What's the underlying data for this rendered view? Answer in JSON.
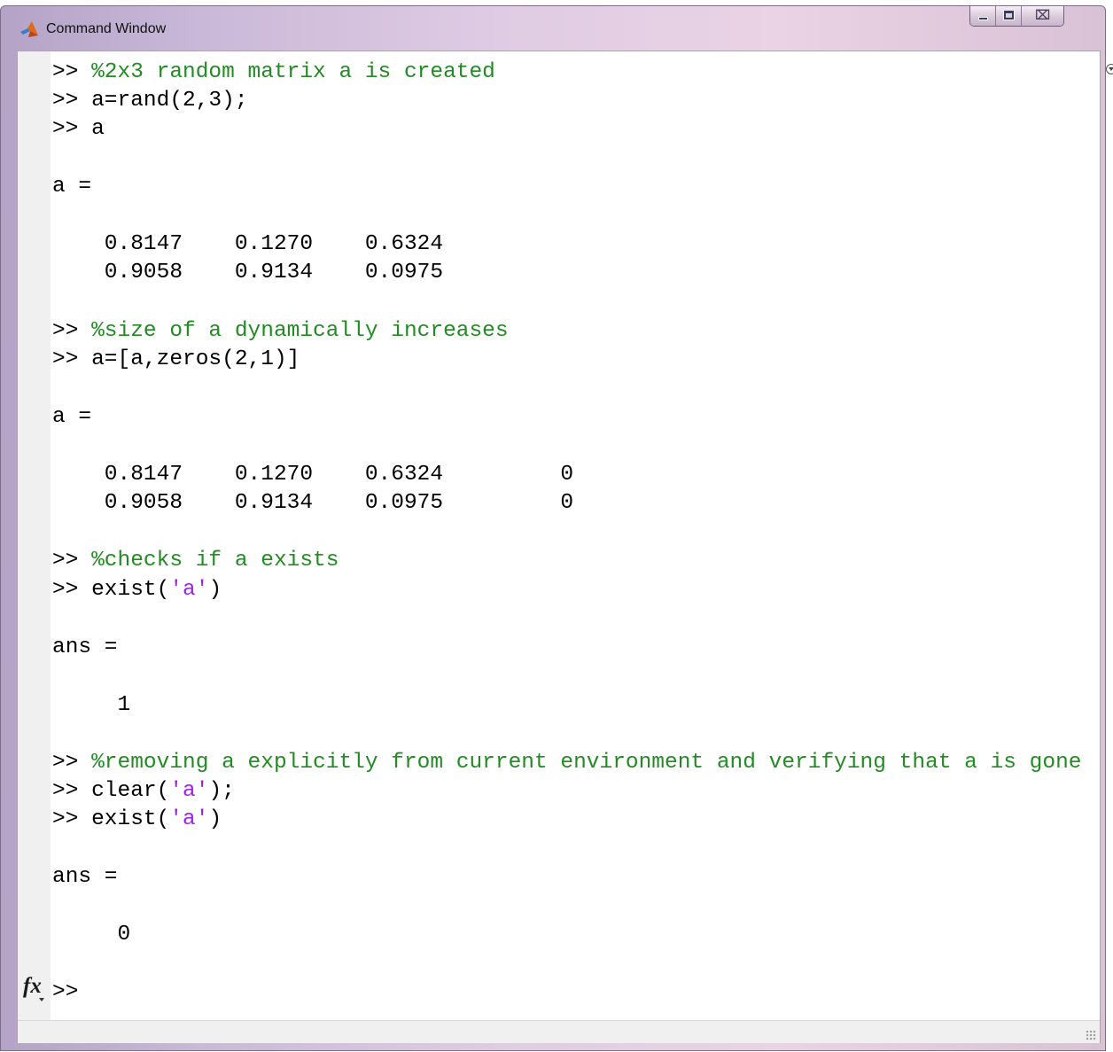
{
  "window": {
    "title": "Command Window",
    "app_icon": "matlab-logo-icon",
    "controls": [
      "minimize-icon",
      "maximize-icon",
      "close-icon"
    ],
    "close_glyph": "⌧"
  },
  "console": {
    "prompt": ">>",
    "lines": [
      {
        "kind": "input",
        "prompt": ">>",
        "comment": "%2x3 random matrix a is created"
      },
      {
        "kind": "input",
        "prompt": ">>",
        "code": "a=rand(2,3);"
      },
      {
        "kind": "input",
        "prompt": ">>",
        "code": "a"
      },
      {
        "kind": "output",
        "text": "a ="
      },
      {
        "kind": "output",
        "text": "    0.8147    0.1270    0.6324"
      },
      {
        "kind": "output",
        "text": "    0.9058    0.9134    0.0975"
      },
      {
        "kind": "input",
        "prompt": ">>",
        "comment": "%size of a dynamically increases"
      },
      {
        "kind": "input",
        "prompt": ">>",
        "code": "a=[a,zeros(2,1)]"
      },
      {
        "kind": "output",
        "text": "a ="
      },
      {
        "kind": "output",
        "text": "    0.8147    0.1270    0.6324         0"
      },
      {
        "kind": "output",
        "text": "    0.9058    0.9134    0.0975         0"
      },
      {
        "kind": "input",
        "prompt": ">>",
        "comment": "%checks if a exists"
      },
      {
        "kind": "input",
        "prompt": ">>",
        "code_pre": "exist(",
        "string": "'a'",
        "code_post": ")"
      },
      {
        "kind": "output",
        "text": "ans ="
      },
      {
        "kind": "output",
        "text": "     1"
      },
      {
        "kind": "input",
        "prompt": ">>",
        "comment": "%removing a explicitly from current environment and verifying that a is gone"
      },
      {
        "kind": "input",
        "prompt": ">>",
        "code_pre": "clear(",
        "string": "'a'",
        "code_post": ");"
      },
      {
        "kind": "input",
        "prompt": ">>",
        "code_pre": "exist(",
        "string": "'a'",
        "code_post": ")"
      },
      {
        "kind": "output",
        "text": "ans ="
      },
      {
        "kind": "output",
        "text": "     0"
      }
    ],
    "active_prompt": ">>",
    "fx_label": "fx",
    "fx_icon": "function-browser-icon"
  },
  "colors": {
    "comment": "#228b22",
    "string": "#a020f0",
    "text": "#000000"
  }
}
